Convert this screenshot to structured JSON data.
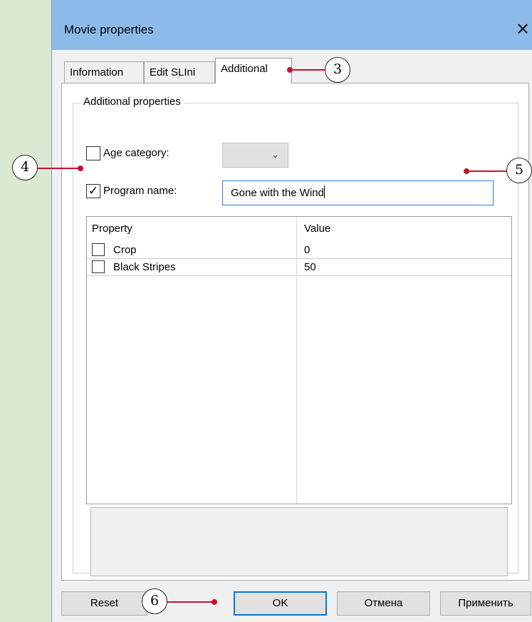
{
  "window": {
    "title": "Movie properties",
    "close_glyph": "✕"
  },
  "tabs": [
    {
      "label": "Information",
      "active": false
    },
    {
      "label": "Edit SLIni",
      "active": false
    },
    {
      "label": "Additional",
      "active": true
    }
  ],
  "additional": {
    "group_title": "Additional properties",
    "age_category": {
      "label": "Age category:",
      "checked": false,
      "value": "",
      "chevron": "⌄"
    },
    "program_name": {
      "label": "Program name:",
      "checked": true,
      "check_glyph": "✓",
      "value": "Gone with the Wind"
    },
    "table": {
      "headers": [
        "Property",
        "Value"
      ],
      "rows": [
        {
          "property": "Crop",
          "value": "0",
          "checked": false
        },
        {
          "property": "Black Stripes",
          "value": "50",
          "checked": false
        }
      ]
    }
  },
  "buttons": {
    "reset": "Reset",
    "ok": "OK",
    "cancel": "Отмена",
    "apply": "Применить"
  },
  "callouts": [
    "3",
    "4",
    "5",
    "6"
  ],
  "colors": {
    "accent_line": "#c8102e",
    "titlebar": "#8dbbe9",
    "focus_border": "#2d7fd6"
  }
}
